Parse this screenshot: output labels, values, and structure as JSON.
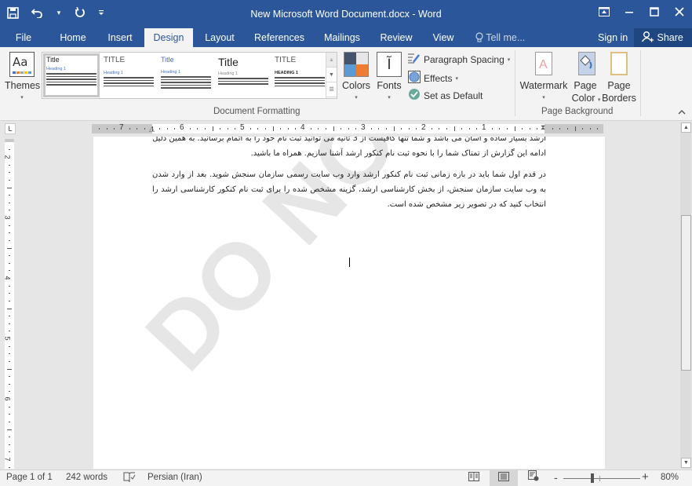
{
  "window": {
    "title": "New Microsoft Word Document.docx - Word",
    "qat": [
      "save-icon",
      "undo-icon",
      "redo-icon",
      "customize-qat-icon"
    ],
    "controls": [
      "ribbon-display-options-icon",
      "minimize-icon",
      "maximize-icon",
      "close-icon"
    ]
  },
  "tabs": [
    {
      "label": "File"
    },
    {
      "label": "Home"
    },
    {
      "label": "Insert"
    },
    {
      "label": "Design",
      "active": true
    },
    {
      "label": "Layout"
    },
    {
      "label": "References"
    },
    {
      "label": "Mailings"
    },
    {
      "label": "Review"
    },
    {
      "label": "View"
    }
  ],
  "tellme": "Tell me...",
  "signin": "Sign in",
  "share": "Share",
  "ribbon": {
    "themes_label": "Themes",
    "gallery": [
      {
        "title": "Title",
        "heading": "Heading 1"
      },
      {
        "title": "TITLE",
        "heading": "Heading 1"
      },
      {
        "title": "Title",
        "heading": "Heading 1"
      },
      {
        "title": "Title",
        "heading": "Heading 1"
      },
      {
        "title": "TITLE",
        "heading": "HEADING 1"
      }
    ],
    "colors_label": "Colors",
    "colors_swatches": [
      "#44546a",
      "#e7e6e6",
      "#5b9bd5",
      "#ed7d31"
    ],
    "fonts_label": "Fonts",
    "fonts_glyph": "آ",
    "paragraph_spacing": "Paragraph Spacing",
    "effects": "Effects",
    "set_default": "Set as Default",
    "group_document_formatting": "Document Formatting",
    "watermark": "Watermark",
    "page_color_1": "Page",
    "page_color_2": "Color",
    "page_borders_1": "Page",
    "page_borders_2": "Borders",
    "group_page_background": "Page Background"
  },
  "ruler": {
    "h_numbers": [
      "7",
      "6",
      "5",
      "4",
      "3",
      "2",
      "1"
    ],
    "v_numbers": [
      "2",
      "3",
      "4",
      "5",
      "6",
      "7"
    ]
  },
  "document": {
    "para0_line1": "ارشد بسیار ساده و آسان می باشد و شما تنها کافیست از 3 ثانیه می توانید ثبت نام خود را به اتمام برسانید. به همین دلیل ما تصمیم داریم در",
    "para0_line2": "ادامه این گزارش از تمتاک شما را با نحوه ثبت نام کنکور ارشد آشنا سازیم. همراه ما باشید.",
    "para1": "در قدم اول شما باید در بازه زمانی ثبت نام کنکور ارشد وارد وب سایت رسمی سازمان سنجش شوید. بعد از وارد شدن به وب سایت سازمان سنجش، از بخش کارشناسی ارشد، گزینه مشخص شده را برای ثبت نام کنکور کارشناسی ارشد را انتخاب کنید که در تصویر زیر مشخص شده است.",
    "watermark_text": "DO NOT COPY"
  },
  "status": {
    "page": "Page 1 of 1",
    "words": "242 words",
    "proofing_icon": "proofing-icon",
    "language": "Persian (Iran)",
    "zoom_minus": "-",
    "zoom_plus": "+",
    "zoom_level": "80%"
  }
}
